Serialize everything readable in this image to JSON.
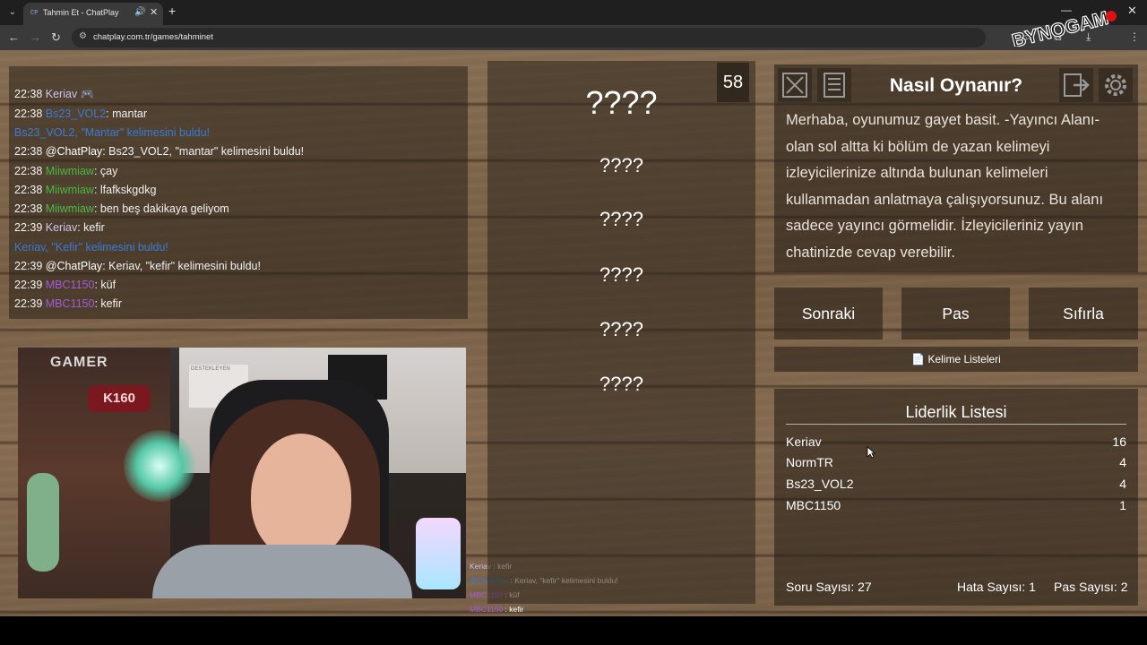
{
  "browser": {
    "tab_title": "Tahmin Et - ChatPlay",
    "tab_favicon": "CP",
    "url": "chatplay.com.tr/games/tahminet",
    "brand_overlay": "BYNOGAM"
  },
  "chat": {
    "lines": [
      {
        "time": "22:38",
        "user": "Keriav",
        "msg": " 🎮",
        "user_color": "#cfc3ef"
      },
      {
        "time": "22:38",
        "user": "Bs23_VOL2",
        "msg": ": mantar",
        "user_color": "#3a7bd5"
      },
      {
        "system": "Bs23_VOL2, \"Mantar\" kelimesini buldu!"
      },
      {
        "time": "22:38",
        "user": "@ChatPlay",
        "msg": ": Bs23_VOL2, \"mantar\" kelimesini buldu!",
        "user_color": "#ffffff"
      },
      {
        "time": "22:38",
        "user": "Miiwmiaw",
        "msg": ": çay",
        "user_color": "#4cbb44"
      },
      {
        "time": "22:38",
        "user": "Miiwmiaw",
        "msg": ": lfafkskgdkg",
        "user_color": "#4cbb44"
      },
      {
        "time": "22:38",
        "user": "Miiwmiaw",
        "msg": ": ben beş dakikaya geliyom",
        "user_color": "#4cbb44"
      },
      {
        "time": "22:39",
        "user": "Keriav",
        "msg": ": kefir",
        "user_color": "#cfc3ef"
      },
      {
        "system": "Keriav, \"Kefir\" kelimesini buldu!"
      },
      {
        "time": "22:39",
        "user": "@ChatPlay",
        "msg": ": Keriav, \"kefir\" kelimesini buldu!",
        "user_color": "#ffffff"
      },
      {
        "time": "22:39",
        "user": "MBC1150",
        "msg": ": küf",
        "user_color": "#a55ad6"
      },
      {
        "time": "22:39",
        "user": "MBC1150",
        "msg": ": kefir",
        "user_color": "#a55ad6"
      }
    ]
  },
  "overlay_chat": [
    {
      "user": "Keriav",
      "msg": " : kefir"
    },
    {
      "user": "@ChatPlay",
      "msg": " : Keriav, \"kefir\" kelimesini buldu!"
    },
    {
      "user": "MBC1150",
      "msg": " : küf"
    },
    {
      "user": "MBC1150",
      "msg": " : kefir"
    }
  ],
  "webcam": {
    "shelf_sign": "GAMER",
    "neon_sign": "K160",
    "poster_text": "DESTEKLEYEN"
  },
  "game": {
    "timer": "58",
    "main_word": "????",
    "forbidden_words": [
      "????",
      "????",
      "????",
      "????",
      "????"
    ]
  },
  "how_to": {
    "title": "Nasıl Oynanır?",
    "text": "Merhaba, oyunumuz gayet basit. -Yayıncı Alanı- olan sol altta ki bölüm de yazan kelimeyi izleyicilerinize altında bulunan kelimeleri kullanmadan anlatmaya çalışıyorsunuz. Bu alanı sadece yayıncı görmelidir. İzleyicileriniz yayın chatinizde cevap verebilir."
  },
  "actions": {
    "next": "Sonraki",
    "pass": "Pas",
    "reset": "Sıfırla",
    "word_lists": "Kelime Listeleri"
  },
  "leaderboard": {
    "title": "Liderlik Listesi",
    "entries": [
      {
        "name": "Keriav",
        "score": "16"
      },
      {
        "name": "NormTR",
        "score": "4"
      },
      {
        "name": "Bs23_VOL2",
        "score": "4"
      },
      {
        "name": "MBC1150",
        "score": "1"
      }
    ]
  },
  "stats": {
    "questions": "Soru Sayısı: 27",
    "errors": "Hata Sayısı: 1",
    "passes": "Pas Sayısı: 2"
  }
}
